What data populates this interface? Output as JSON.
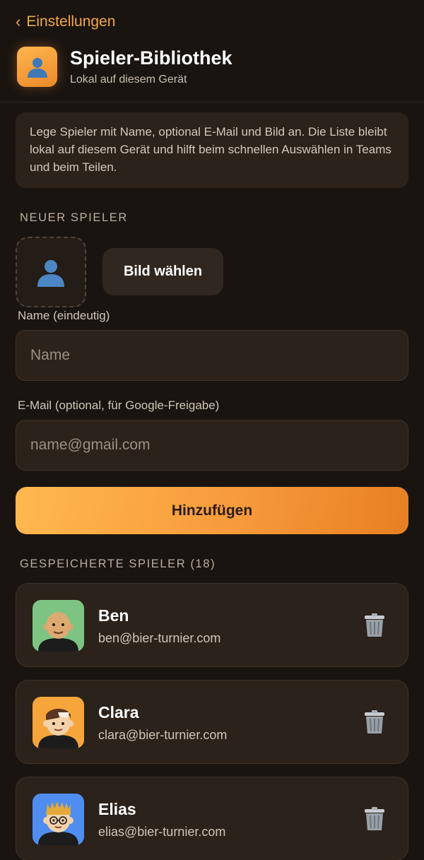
{
  "nav": {
    "back_label": "Einstellungen"
  },
  "header": {
    "title": "Spieler-Bibliothek",
    "subtitle": "Lokal auf diesem Gerät"
  },
  "info_text": "Lege Spieler mit Name, optional E-Mail und Bild an. Die Liste bleibt lokal auf diesem Gerät und hilft beim schnellen Auswählen in Teams und beim Teilen.",
  "new_player": {
    "section_label": "NEUER SPIELER",
    "choose_image_label": "Bild wählen",
    "name_label": "Name (eindeutig)",
    "name_placeholder": "Name",
    "email_label": "E-Mail (optional, für Google-Freigabe)",
    "email_placeholder": "name@gmail.com",
    "add_button": "Hinzufügen"
  },
  "saved": {
    "section_label": "GESPEICHERTE SPIELER (18)",
    "players": [
      {
        "name": "Ben",
        "email": "ben@bier-turnier.com",
        "avatar_bg": "#7dc483"
      },
      {
        "name": "Clara",
        "email": "clara@bier-turnier.com",
        "avatar_bg": "#f5a53a"
      },
      {
        "name": "Elias",
        "email": "elias@bier-turnier.com",
        "avatar_bg": "#4f8ef0"
      }
    ]
  },
  "colors": {
    "accent": "#f0a94a",
    "background": "#1a1410",
    "card": "#2b221b"
  }
}
